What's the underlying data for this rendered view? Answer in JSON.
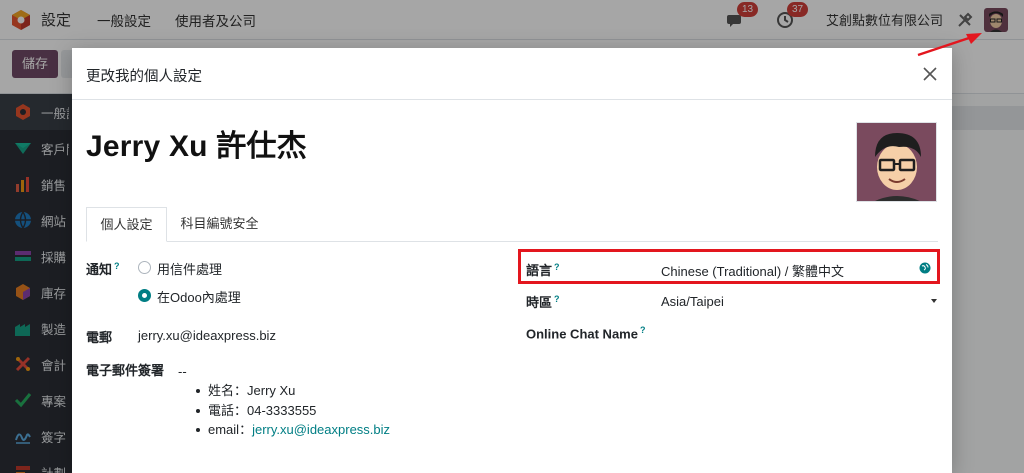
{
  "navbar": {
    "app_name": "設定",
    "menu": [
      "一般設定",
      "使用者及公司"
    ],
    "messages_count": "13",
    "activities_count": "37",
    "company": "艾創點數位有限公司"
  },
  "control_bar": {
    "save_label": "儲存"
  },
  "sidebar": {
    "items": [
      {
        "label": "一般設定",
        "icon": "settings-app-icon",
        "color": "#e6532e"
      },
      {
        "label": "客戶關係",
        "icon": "crm-app-icon",
        "color": "#17a589"
      },
      {
        "label": "銷售",
        "icon": "sales-app-icon",
        "color": "#e05d44"
      },
      {
        "label": "網站",
        "icon": "website-app-icon",
        "color": "#1f7bc1"
      },
      {
        "label": "採購",
        "icon": "purchase-app-icon",
        "color": "#8e44ad"
      },
      {
        "label": "庫存",
        "icon": "inventory-app-icon",
        "color": "#e67e22"
      },
      {
        "label": "製造",
        "icon": "manufacturing-app-icon",
        "color": "#16a085"
      },
      {
        "label": "會計",
        "icon": "accounting-app-icon",
        "color": "#e74c3c"
      },
      {
        "label": "專案",
        "icon": "project-app-icon",
        "color": "#27ae60"
      },
      {
        "label": "簽字",
        "icon": "sign-app-icon",
        "color": "#2980b9"
      },
      {
        "label": "計劃",
        "icon": "planning-app-icon",
        "color": "#c0392b"
      }
    ]
  },
  "modal": {
    "title": "更改我的個人設定",
    "user_name": "Jerry Xu 許仕杰",
    "tabs": [
      {
        "label": "個人設定",
        "active": true
      },
      {
        "label": "科目編號安全",
        "active": false
      }
    ],
    "notification": {
      "label": "通知",
      "options": [
        {
          "label": "用信件處理",
          "checked": false
        },
        {
          "label": "在Odoo內處理",
          "checked": true
        }
      ]
    },
    "email": {
      "label": "電郵",
      "value": "jerry.xu@ideaxpress.biz"
    },
    "signature": {
      "label": "電子郵件簽署",
      "separator": "--",
      "lines": [
        {
          "prefix": "姓名：",
          "text": "Jerry Xu"
        },
        {
          "prefix": "電話：",
          "text": "04-3333555"
        },
        {
          "prefix": "email：",
          "text": "jerry.xu@ideaxpress.biz",
          "is_link": true
        }
      ]
    },
    "language": {
      "label": "語言",
      "value": "Chinese (Traditional) / 繁體中文"
    },
    "timezone": {
      "label": "時區",
      "value": "Asia/Taipei"
    },
    "online_chat_name": {
      "label": "Online Chat Name",
      "value": ""
    },
    "help_mark": "?"
  },
  "colors": {
    "brand": "#714b67",
    "accent": "#017e84",
    "highlight": "#e3161e",
    "badge": "#d23f3a"
  }
}
